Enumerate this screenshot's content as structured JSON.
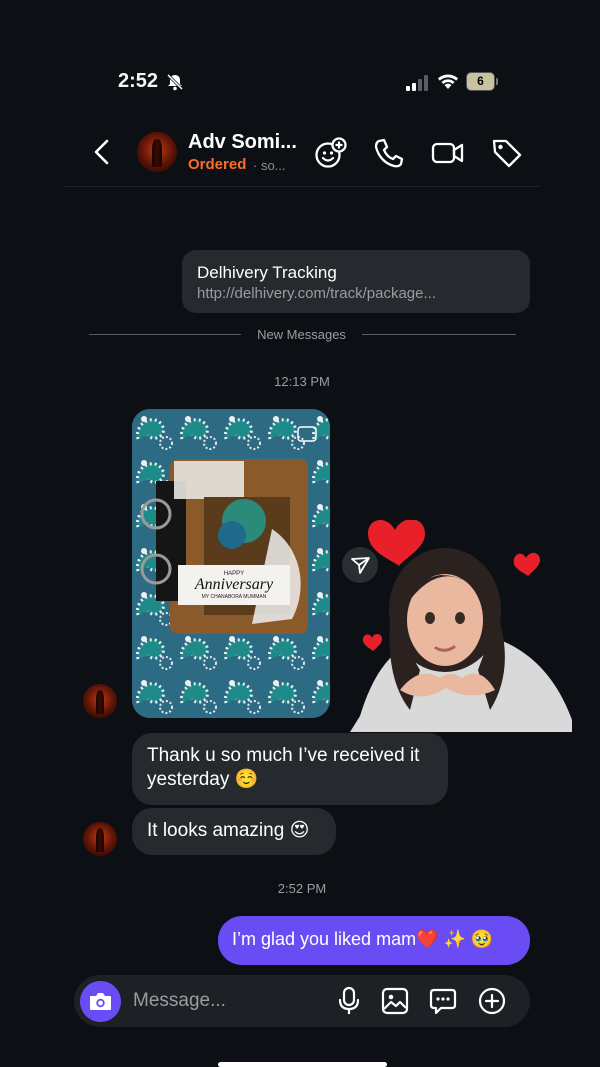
{
  "status_bar": {
    "time": "2:52",
    "battery": "6"
  },
  "header": {
    "name": "Adv Somi...",
    "status": "Ordered",
    "subtitle": "· so..."
  },
  "icons": {
    "back": "chevron-left-icon",
    "effects": "sticker-add-icon",
    "call": "phone-icon",
    "video": "video-camera-icon",
    "label": "tag-icon",
    "share": "send-icon",
    "camera": "camera-icon",
    "mic": "microphone-icon",
    "gallery": "image-icon",
    "sticker": "chat-bubble-icon",
    "add": "plus-circle-icon"
  },
  "link_card": {
    "title": "Delhivery Tracking",
    "url": "http://delhivery.com/track/package..."
  },
  "divider": {
    "label": "New Messages"
  },
  "messages": {
    "time1": "12:13 PM",
    "photo_text": {
      "line1": "HAPPY",
      "line2": "Anniversary",
      "line3": "MY CHANABORA MUMMAN"
    },
    "incoming1": "Thank u so much I’ve received it yesterday ☺️",
    "incoming2": "It looks amazing 😍",
    "time2": "2:52 PM",
    "outgoing1": "I’m glad you liked mam❤️ ✨ 🥹"
  },
  "composer": {
    "placeholder": "Message..."
  },
  "colors": {
    "accent": "#6a4cf5",
    "status_orange": "#ff6a2b",
    "background": "#0c1014",
    "bubble_in": "#26292e"
  }
}
